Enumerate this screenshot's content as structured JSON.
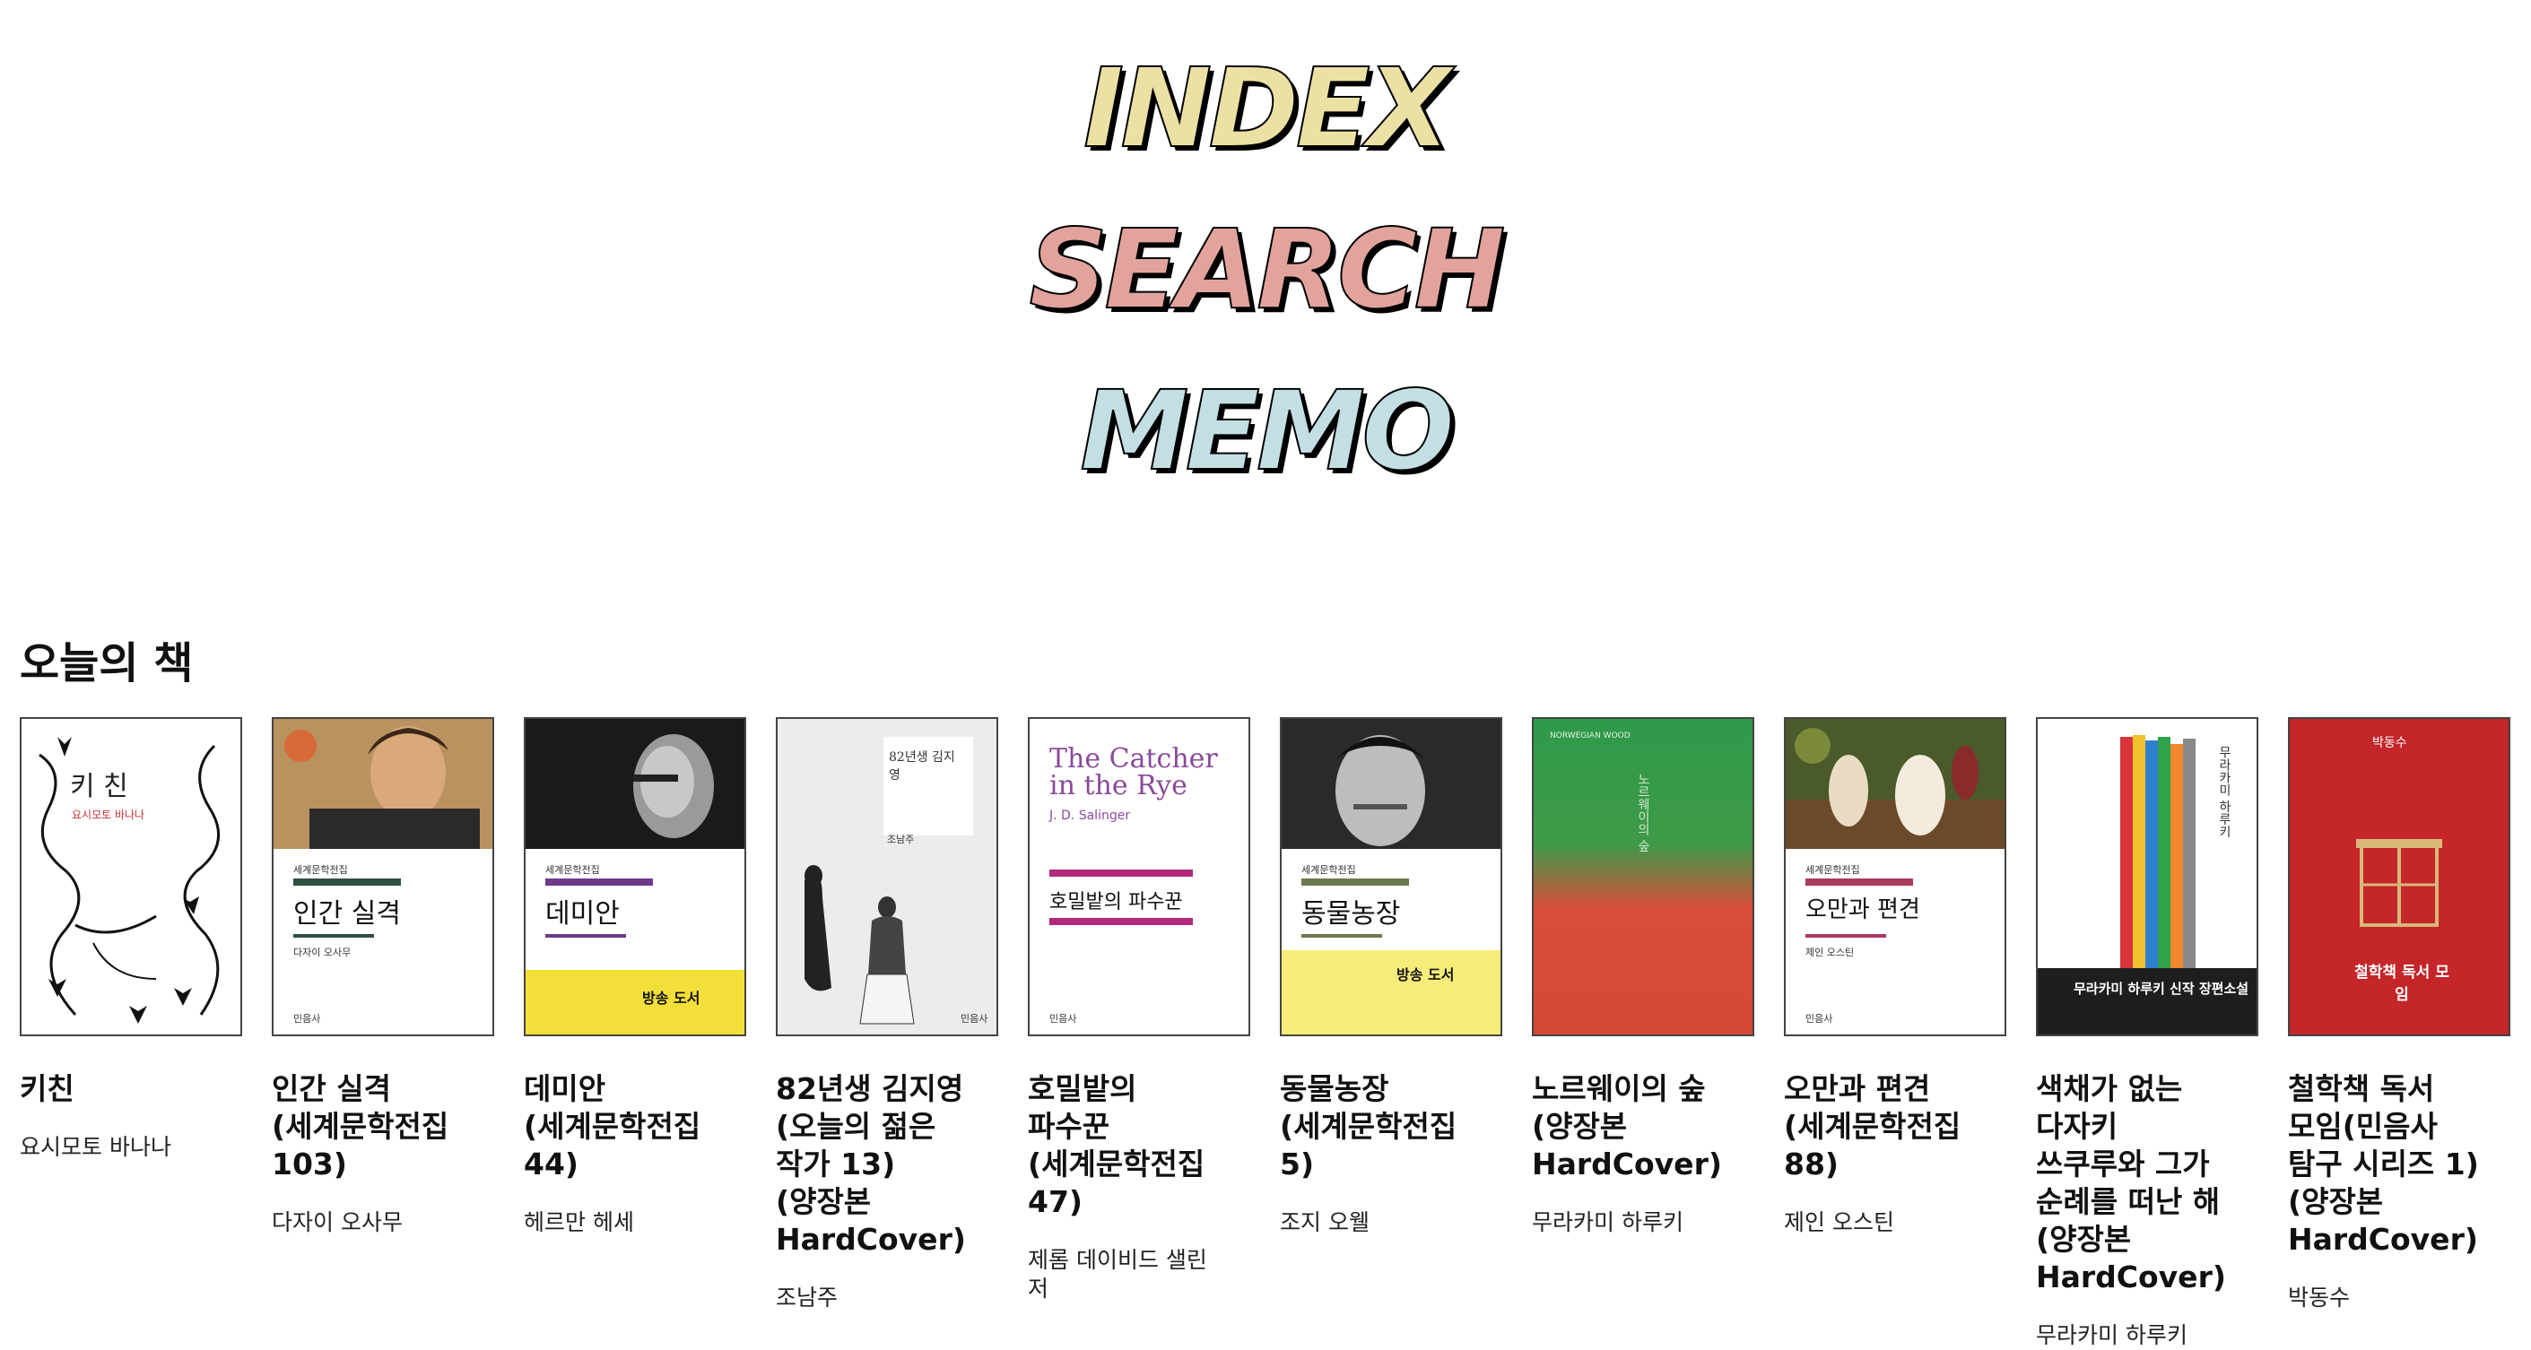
{
  "nav": {
    "index_label": "INDEX",
    "search_label": "SEARCH",
    "memo_label": "MEMO"
  },
  "section": {
    "title": "오늘의 책"
  },
  "books": [
    {
      "title": "키친",
      "author": "요시모토 바나나",
      "cover_text": "키 친",
      "cover_sub": "요시모토 바나나"
    },
    {
      "title": "인간 실격(세계문학전집 103)",
      "author": "다자이 오사무",
      "cover_text": "인간 실격",
      "cover_sub": "다자이 오사무"
    },
    {
      "title": "데미안(세계문학전집 44)",
      "author": "헤르만 헤세",
      "cover_text": "데미안",
      "cover_sub": "방송 도서"
    },
    {
      "title": "82년생 김지영(오늘의 젊은 작가 13)(양장본 HardCover)",
      "author": "조남주",
      "cover_text": "82년생 김지영",
      "cover_sub": "조남주"
    },
    {
      "title": "호밀밭의 파수꾼(세계문학전집 47)",
      "author": "제롬 데이비드 샐린저",
      "cover_text": "The Catcher in the Rye",
      "cover_sub": "호밀밭의 파수꾼"
    },
    {
      "title": "동물농장(세계문학전집 5)",
      "author": "조지 오웰",
      "cover_text": "동물농장",
      "cover_sub": "방송 도서"
    },
    {
      "title": "노르웨이의 숲(양장본 HardCover)",
      "author": "무라카미 하루키",
      "cover_text": "노르웨이의 숲",
      "cover_sub": "NORWEGIAN WOOD"
    },
    {
      "title": "오만과 편견(세계문학전집 88)",
      "author": "제인 오스틴",
      "cover_text": "오만과 편견",
      "cover_sub": "제인 오스틴"
    },
    {
      "title": "색채가 없는 다자키 쓰쿠루와 그가 순례를 떠난 해(양장본 HardCover)",
      "author": "무라카미 하루키",
      "cover_text": "무라카미 하루키 신작 장편소설",
      "cover_sub": "무라카미 하루키"
    },
    {
      "title": "철학책 독서 모임(민음사 탐구 시리즈 1)(양장본 HardCover)",
      "author": "박동수",
      "cover_text": "철학책 독서 모임",
      "cover_sub": "박동수"
    }
  ],
  "colors": {
    "index": "#ece1a4",
    "search": "#e2a39d",
    "memo": "#c3dfe4"
  }
}
